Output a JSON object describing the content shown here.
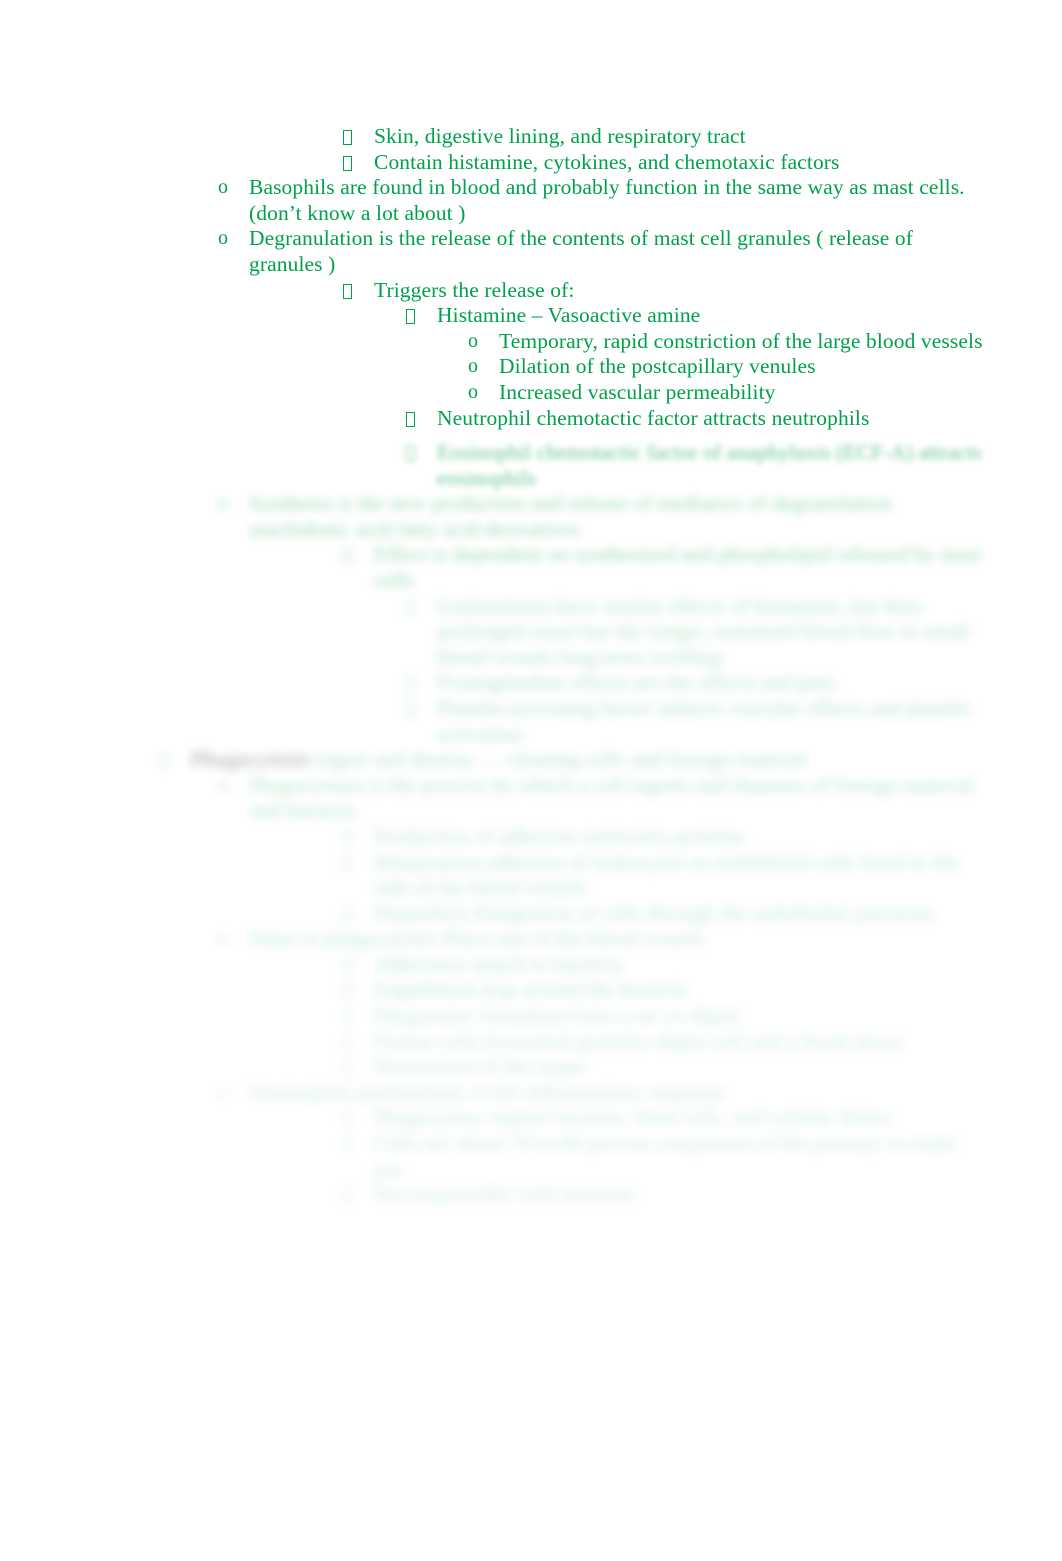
{
  "document": {
    "page_background": "#ffffff",
    "text_color": "#00a14b",
    "heading_color": "#1a1a1a",
    "topic": "Inflammation notes — mast cells, basophils, degranulation, phagocytosis"
  },
  "outline": {
    "sharp": [
      {
        "id": "l01",
        "level": 4,
        "marker": "tofu",
        "text": "Skin, digestive lining, and respiratory tract"
      },
      {
        "id": "l02",
        "level": 4,
        "marker": "tofu",
        "text": "Contain histamine, cytokines, and chemotaxic factors"
      },
      {
        "id": "l03",
        "level": 2,
        "marker": "o",
        "text": "Basophils are found in blood and probably function in the same way as mast cells. (don’t know a lot about )"
      },
      {
        "id": "l04",
        "level": 2,
        "marker": "o",
        "text": "Degranulation  is the release of the contents of mast cell granules (  release of granules )"
      },
      {
        "id": "l05",
        "level": 4,
        "marker": "tofu",
        "text": "Triggers the release of:"
      },
      {
        "id": "l06",
        "level": 5,
        "marker": "tofu",
        "text": "Histamine – Vasoactive amine"
      },
      {
        "id": "l07",
        "level": 6,
        "marker": "o",
        "text": "Temporary, rapid constriction of the large blood vessels"
      },
      {
        "id": "l08",
        "level": 6,
        "marker": "o",
        "text": "Dilation of the postcapillary venules"
      },
      {
        "id": "l09",
        "level": 6,
        "marker": "o",
        "text": "Increased vascular permeability"
      },
      {
        "id": "l10",
        "level": 5,
        "marker": "tofu",
        "text": "Neutrophil chemotactic factor   attracts neutrophils"
      }
    ],
    "blurred": [
      {
        "id": "b01",
        "level": 5,
        "marker": "tofu",
        "blur": "a",
        "text": "Eosinophil chemotactic factor of anaphylaxis (ECF-A)  attracts eosinophils"
      },
      {
        "id": "b02",
        "level": 2,
        "marker": "o",
        "blur": "b",
        "text": "Synthesis is the new production and release of mediators of degranulation  arachidonic acid fatty acid  derivatives"
      },
      {
        "id": "b03",
        "level": 4,
        "marker": "tofu",
        "blur": "b",
        "text": "Effect is dependent on synthesized and phospholipid released by mast cells"
      },
      {
        "id": "b04",
        "level": 5,
        "marker": "tofu",
        "blur": "c",
        "text": "Leukotrienes  have similar effects of histamine, but their prolonged onset has the longer, sustained blood flow in small blood vessels long term swelling"
      },
      {
        "id": "b05",
        "level": 5,
        "marker": "tofu",
        "blur": "c",
        "text": "Prostaglandins  effects are the effects and pain"
      },
      {
        "id": "b06",
        "level": 5,
        "marker": "tofu",
        "blur": "c",
        "text": "Platelet-activating factor  induces vascular effects and platelet activation"
      },
      {
        "id": "b07",
        "level": 1,
        "marker": "bold",
        "blur": "c",
        "heading": "Phagocytosis",
        "text": " ingest and destroy — cleaning cells and foreign material"
      },
      {
        "id": "b08",
        "level": 2,
        "marker": "o",
        "blur": "c",
        "text": "Phagocytosis is the process by which a cell ingests and disposes of foreign material and bacteria"
      },
      {
        "id": "b09",
        "level": 4,
        "marker": "tofu",
        "blur": "d",
        "text": "Production of adhesion molecules  proteins"
      },
      {
        "id": "b10",
        "level": 4,
        "marker": "tofu",
        "blur": "d",
        "text": "Margination  adhesion of leukocytes to endothelial cells lined in the side of the blood vessels"
      },
      {
        "id": "b11",
        "level": 4,
        "marker": "tofu",
        "blur": "d",
        "text": "Diapedesis  Emigration of cells through the endothelial junctions"
      },
      {
        "id": "b12",
        "level": 2,
        "marker": "o",
        "blur": "d",
        "text": "Steps in phagocytosis  Place one of the blood vessels"
      },
      {
        "id": "b13",
        "level": 4,
        "marker": "tofu",
        "blur": "d",
        "text": "Adherence  attach to bacteria"
      },
      {
        "id": "b14",
        "level": 4,
        "marker": "tofu",
        "blur": "d",
        "text": "Engulfment  trap around the bacteria"
      },
      {
        "id": "b15",
        "level": 4,
        "marker": "tofu",
        "blur": "e",
        "text": "Phagosome formation  form a sac to digest"
      },
      {
        "id": "b16",
        "level": 4,
        "marker": "tofu",
        "blur": "e",
        "text": "Fusion with lysosomal granules  digest cell and a break down"
      },
      {
        "id": "b17",
        "level": 4,
        "marker": "tofu",
        "blur": "e",
        "text": "Destruction of the target"
      },
      {
        "id": "b18",
        "level": 2,
        "marker": "o",
        "blur": "e",
        "text": "Neutrophils predominate in the inflammatory response"
      },
      {
        "id": "b19",
        "level": 4,
        "marker": "tofu",
        "blur": "e",
        "text": "Phagocytose ingests bacteria, dead cells, and cellular debris"
      },
      {
        "id": "b20",
        "level": 4,
        "marker": "tofu",
        "blur": "e",
        "text": "Cells are about 70 to 80 percent   component of the primary to make pus"
      },
      {
        "id": "b21",
        "level": 4,
        "marker": "tofu",
        "blur": "e",
        "text": "Not responsible with invasion"
      }
    ]
  }
}
